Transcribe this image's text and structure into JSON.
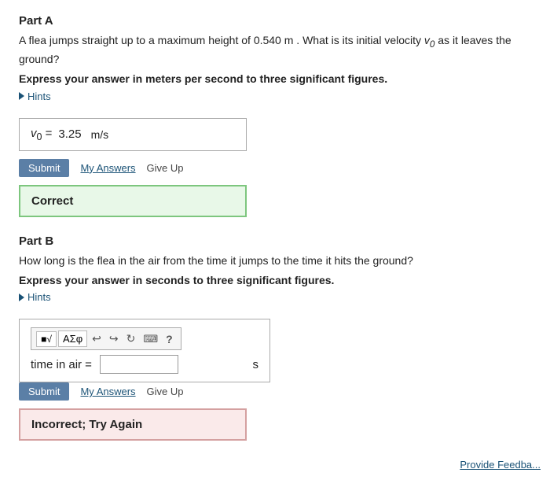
{
  "page": {
    "background": "#fff"
  },
  "partA": {
    "title": "Part A",
    "question": "A flea jumps straight up to a maximum height of 0.540 m . What is its initial velocity v₀ as it leaves the ground?",
    "instruction": "Express your answer in meters per second to three significant figures.",
    "hints_label": "Hints",
    "answer_label": "v₀ =",
    "answer_value": "3.25",
    "unit": "m/s",
    "submit_label": "Submit",
    "my_answers_label": "My Answers",
    "give_up_label": "Give Up",
    "result_label": "Correct"
  },
  "partB": {
    "title": "Part B",
    "question": "How long is the flea in the air from the time it jumps to the time it hits the ground?",
    "instruction": "Express your answer in seconds to three significant figures.",
    "hints_label": "Hints",
    "answer_prefix": "time in air =",
    "unit": "s",
    "submit_label": "Submit",
    "my_answers_label": "My Answers",
    "give_up_label": "Give Up",
    "result_label": "Incorrect; Try Again",
    "toolbar": {
      "btn1": "■√",
      "btn2": "AΣφ",
      "undo": "↩",
      "redo": "↪",
      "refresh": "↻",
      "keyboard": "⌨",
      "help": "?"
    }
  },
  "footer": {
    "provide_feedback_label": "Provide Feedba..."
  }
}
